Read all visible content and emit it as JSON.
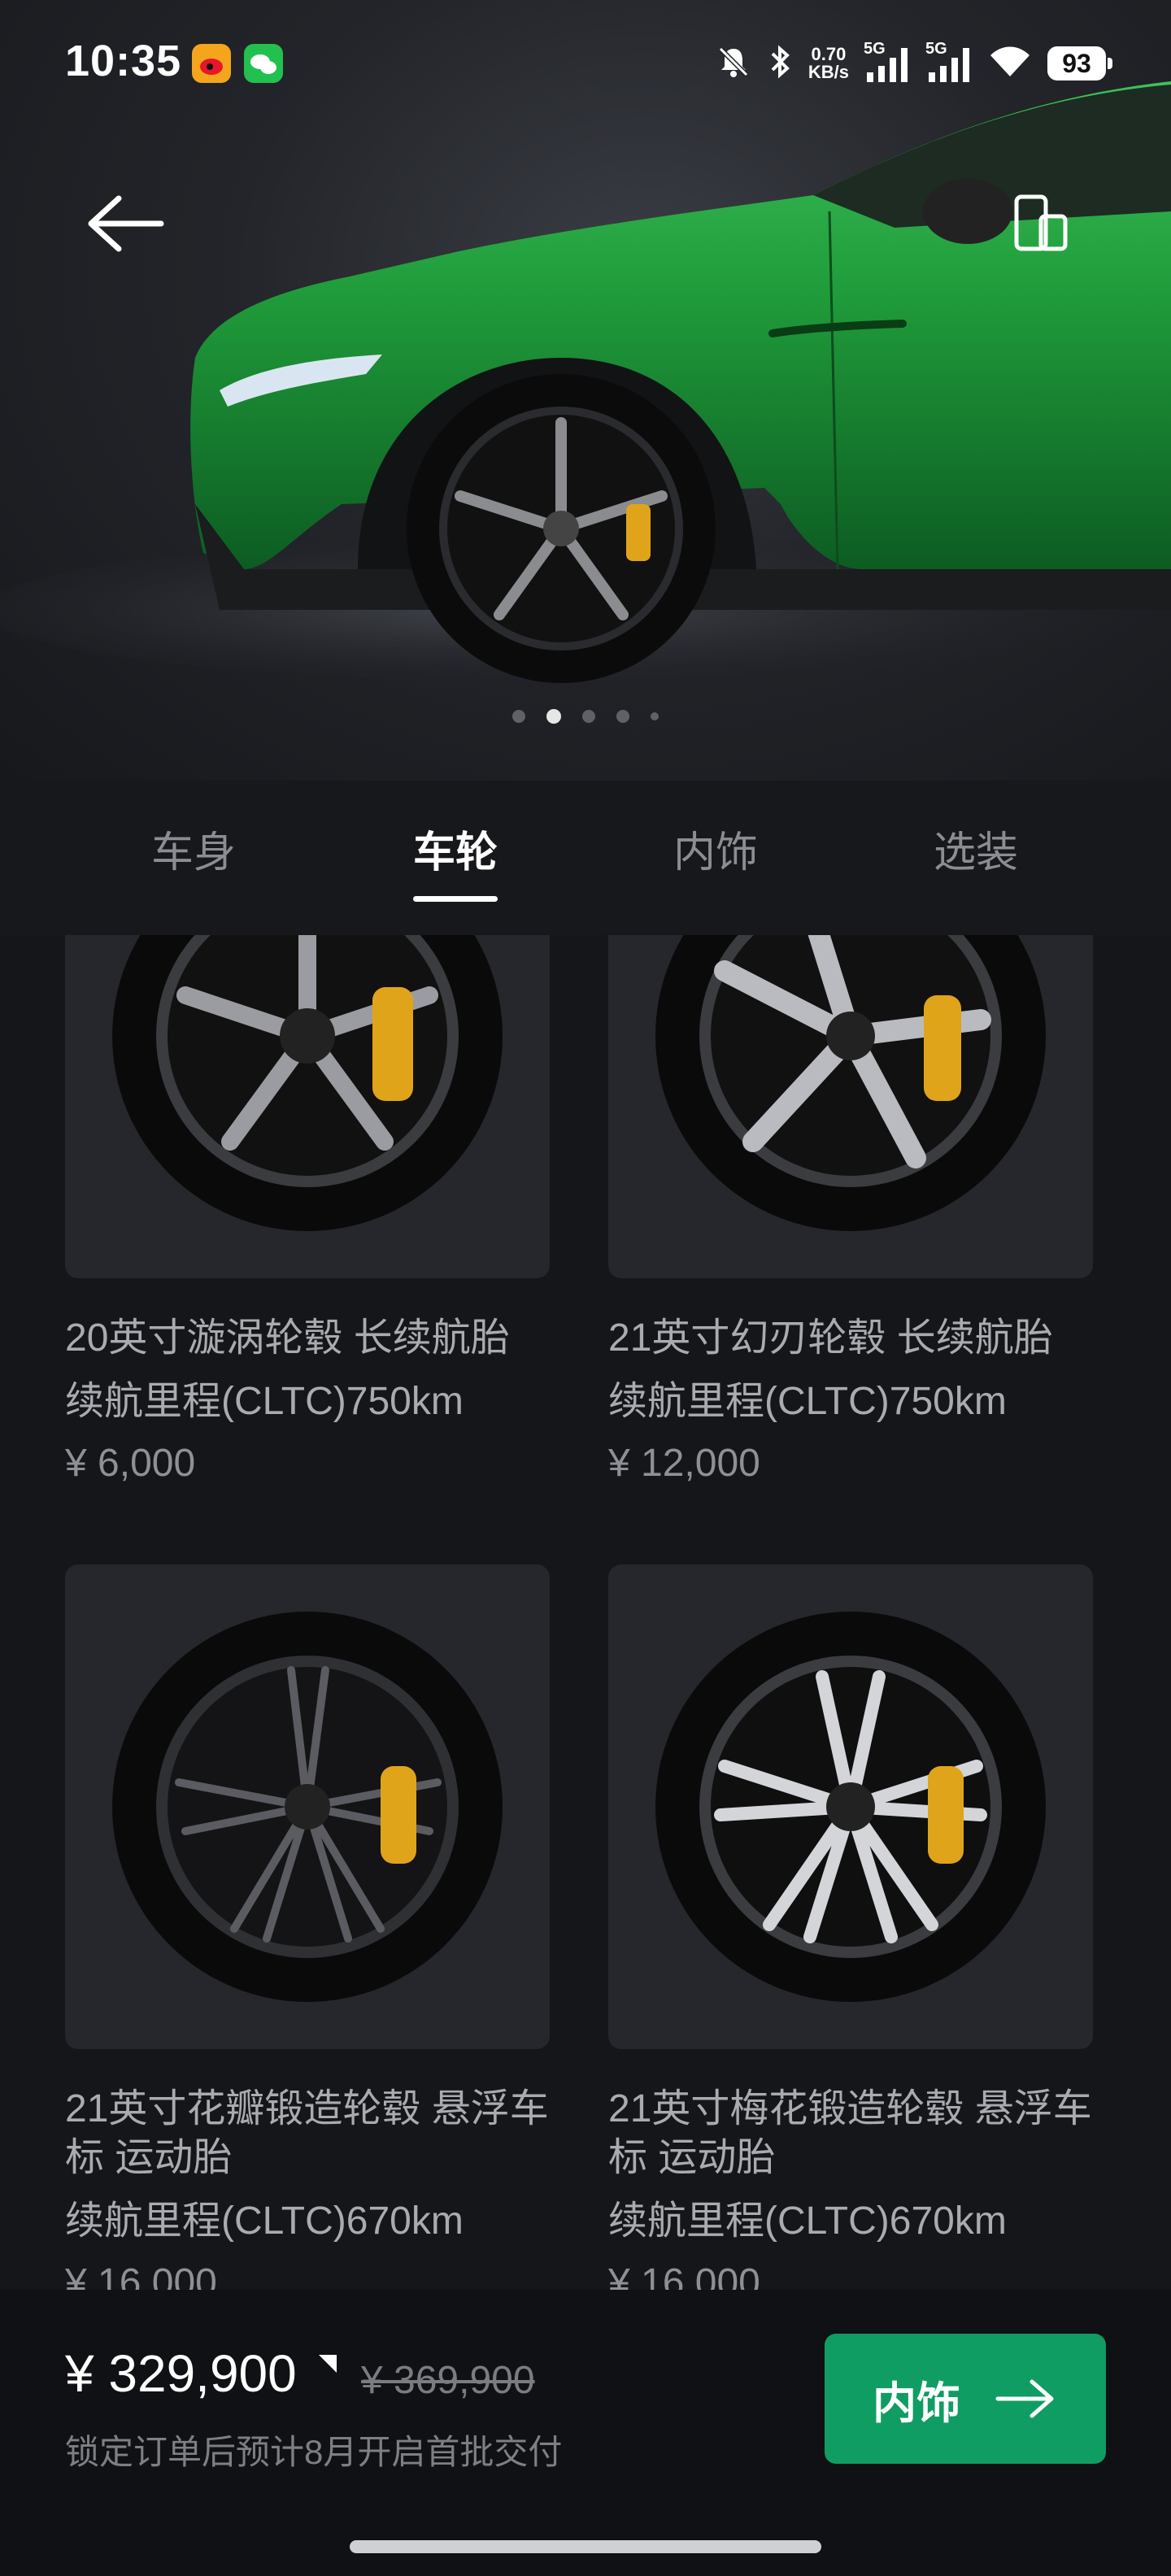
{
  "status_bar": {
    "time": "10:35",
    "net_speed_value": "0.70",
    "net_speed_unit": "KB/s",
    "signal_1_label": "5G",
    "signal_2_label": "5G",
    "battery": "93",
    "icons": [
      "weibo-icon",
      "wechat-icon",
      "mute-bell-icon",
      "bluetooth-icon",
      "signal-icon",
      "wifi-icon",
      "battery-icon"
    ]
  },
  "hero": {
    "carousel_count": 5,
    "carousel_active": 1,
    "car_color": "#1f9a3a"
  },
  "tabs": [
    {
      "label": "车身",
      "active": false
    },
    {
      "label": "车轮",
      "active": true
    },
    {
      "label": "内饰",
      "active": false
    },
    {
      "label": "选装",
      "active": false
    }
  ],
  "wheels": [
    {
      "title": "20英寸漩涡轮毂 长续航胎",
      "range": "续航里程(CLTC)750km",
      "price": "¥ 6,000"
    },
    {
      "title": "21英寸幻刃轮毂 长续航胎",
      "range": "续航里程(CLTC)750km",
      "price": "¥ 12,000"
    },
    {
      "title": "21英寸花瓣锻造轮毂 悬浮车标 运动胎",
      "range": "续航里程(CLTC)670km",
      "price": "¥ 16,000"
    },
    {
      "title": "21英寸梅花锻造轮毂 悬浮车标 运动胎",
      "range": "续航里程(CLTC)670km",
      "price": "¥ 16,000"
    }
  ],
  "bottom_bar": {
    "price_now": "¥ 329,900",
    "price_old": "¥ 369,900",
    "delivery_note": "锁定订单后预计8月开启首批交付",
    "next_label": "内饰",
    "accent": "#0f9d63"
  }
}
